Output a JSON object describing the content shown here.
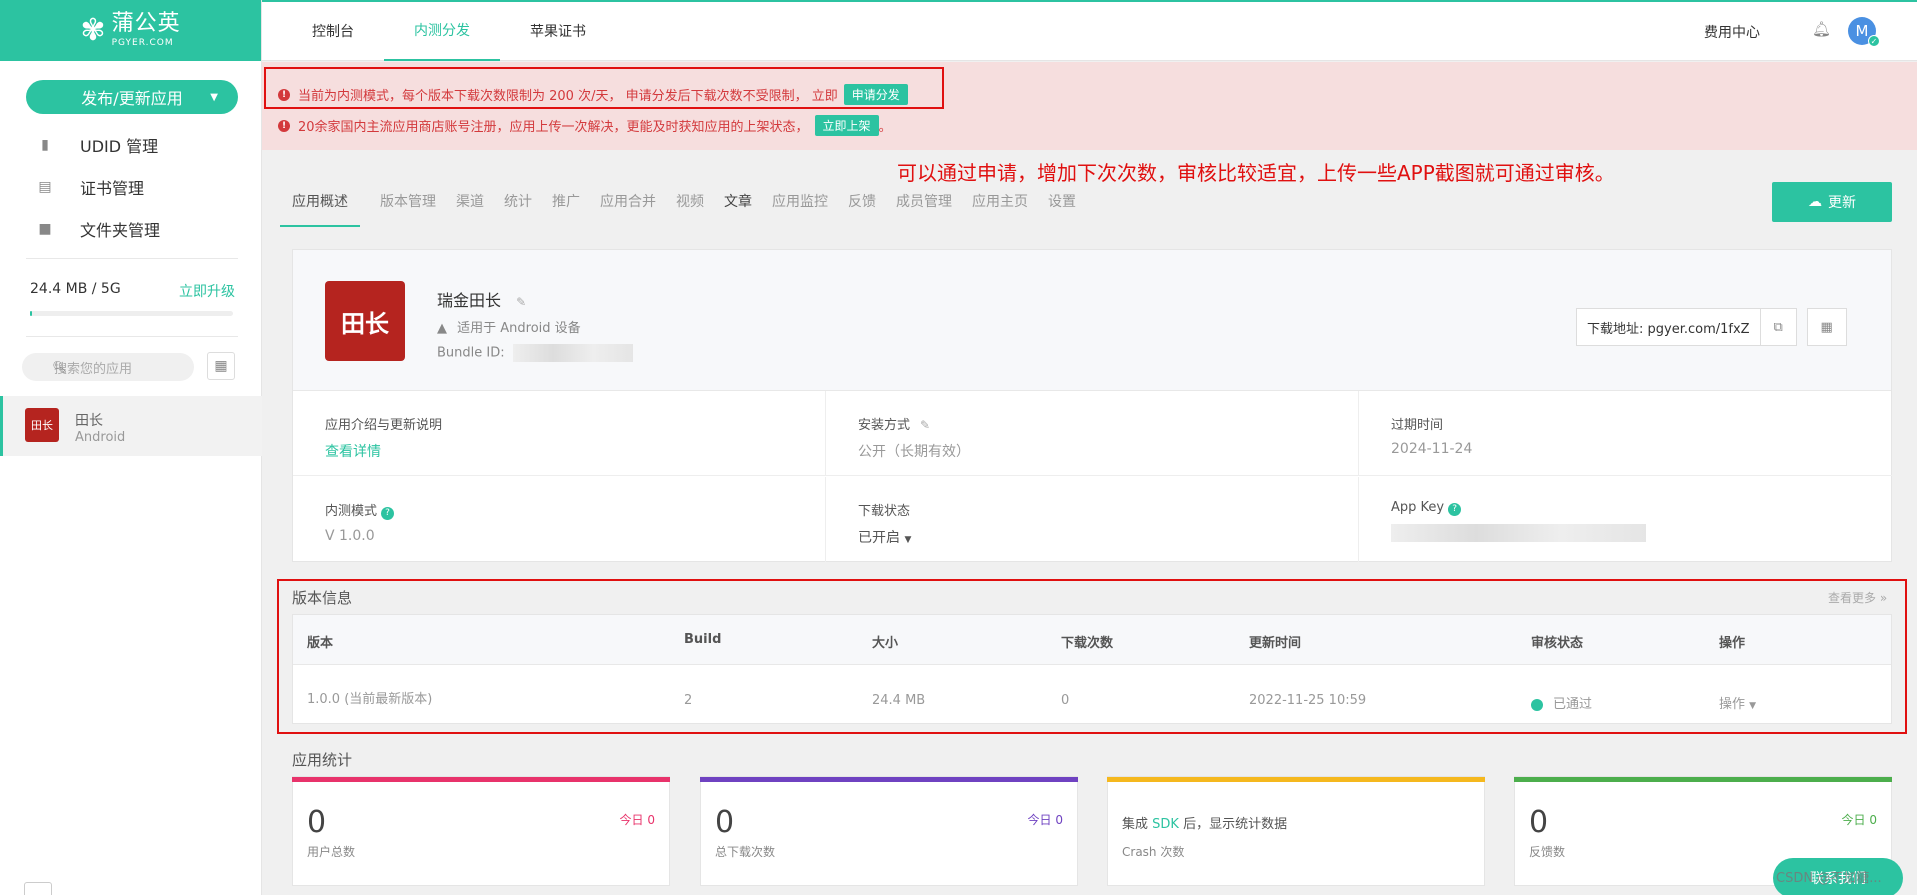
{
  "logo": {
    "name": "蒲公英",
    "domain": "PGYER.COM"
  },
  "sidebar": {
    "publish_label": "发布/更新应用",
    "items": [
      {
        "label": "UDID 管理",
        "icon": "phone-icon"
      },
      {
        "label": "证书管理",
        "icon": "certificate-icon"
      },
      {
        "label": "文件夹管理",
        "icon": "folder-icon"
      }
    ],
    "storage": "24.4 MB / 5G",
    "storage_used_fraction": 0.005,
    "upgrade": "立即升级",
    "search_placeholder": "搜索您的应用",
    "app": {
      "name": "田长",
      "platform": "Android"
    }
  },
  "topnav": {
    "tabs": [
      "控制台",
      "内测分发",
      "苹果证书"
    ],
    "active": "内测分发",
    "fee": "费用中心",
    "avatar_letter": "M"
  },
  "alerts": [
    {
      "text": "当前为内测模式，每个版本下载次数限制为 200 次/天， 申请分发后下载次数不受限制， 立即",
      "button": "申请分发",
      "tail": ""
    },
    {
      "text": "20余家国内主流应用商店账号注册，应用上传一次解决，更能及时获知应用的上架状态，",
      "button": "立即上架",
      "tail": "。"
    }
  ],
  "annotation": "可以通过申请，增加下次次数，审核比较适宜，上传一些APP截图就可通过审核。",
  "tabs": [
    "应用概述",
    "版本管理",
    "渠道",
    "统计",
    "推广",
    "应用合并",
    "视频",
    "文章",
    "应用监控",
    "反馈",
    "成员管理",
    "应用主页",
    "设置"
  ],
  "update_label": "更新",
  "app": {
    "icon_text": "田长",
    "name": "瑞金田长",
    "platform": "适用于 Android 设备",
    "bundle_label": "Bundle ID:",
    "download_label": "下载地址: pgyer.com/1fxZ"
  },
  "info": {
    "intro_label": "应用介绍与更新说明",
    "intro_link": "查看详情",
    "install_label": "安装方式",
    "install_value": "公开（长期有效）",
    "expire_label": "过期时间",
    "expire_value": "2024-11-24",
    "mode_label": "内测模式",
    "mode_value": "V 1.0.0",
    "dl_status_label": "下载状态",
    "dl_status_value": "已开启",
    "appkey_label": "App Key"
  },
  "versions": {
    "title": "版本信息",
    "more": "查看更多",
    "columns": [
      "版本",
      "Build",
      "大小",
      "下载次数",
      "更新时间",
      "审核状态",
      "操作"
    ],
    "rows": [
      {
        "version": "1.0.0 (当前最新版本)",
        "build": "2",
        "size": "24.4 MB",
        "downloads": "0",
        "updated": "2022-11-25 10:59",
        "status": "已通过",
        "action": "操作"
      }
    ]
  },
  "stats": {
    "title": "应用统计",
    "cards": [
      {
        "num": "0",
        "label": "用户总数",
        "today": "今日 0",
        "color": "#e8336b"
      },
      {
        "num": "0",
        "label": "总下载次数",
        "today": "今日 0",
        "color": "#6f42c1"
      },
      {
        "msg_pre": "集成 ",
        "msg_sdk": "SDK",
        "msg_post": " 后，显示统计数据",
        "label": "Crash 次数",
        "color": "#f5b81e"
      },
      {
        "num": "0",
        "label": "反馈数",
        "today": "今日 0",
        "color": "#4cae4c"
      }
    ]
  },
  "contact": "联系我们",
  "watermark": "CSDN @不加糖..."
}
